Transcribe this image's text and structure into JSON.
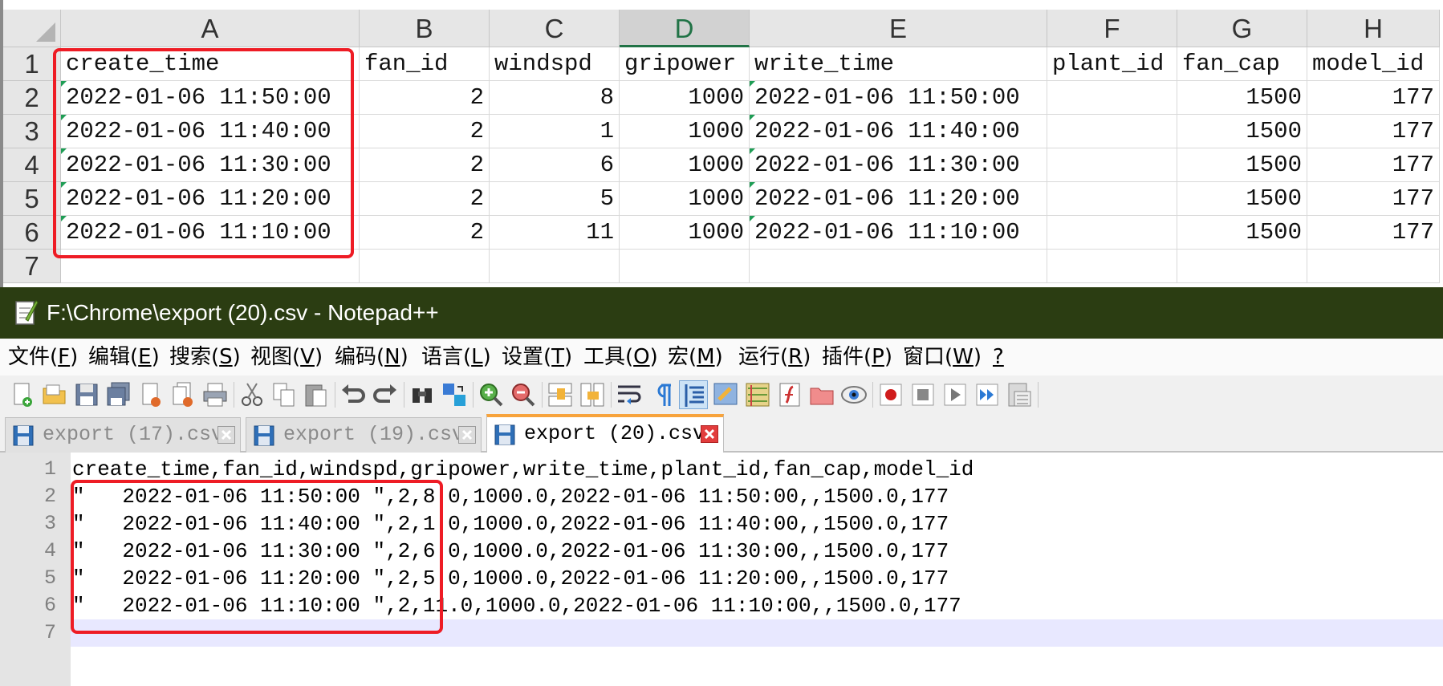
{
  "spreadsheet": {
    "columns": [
      "A",
      "B",
      "C",
      "D",
      "E",
      "F",
      "G",
      "H"
    ],
    "selected_column": "D",
    "row_numbers": [
      "1",
      "2",
      "3",
      "4",
      "5",
      "6",
      "7"
    ],
    "header": [
      "create_time",
      "fan_id",
      "windspd",
      "gripower",
      "write_time",
      "plant_id",
      "fan_cap",
      "model_id"
    ],
    "rows": [
      [
        "2022-01-06 11:50:00",
        "2",
        "8",
        "1000",
        "2022-01-06 11:50:00",
        "",
        "1500",
        "177"
      ],
      [
        "2022-01-06 11:40:00",
        "2",
        "1",
        "1000",
        "2022-01-06 11:40:00",
        "",
        "1500",
        "177"
      ],
      [
        "2022-01-06 11:30:00",
        "2",
        "6",
        "1000",
        "2022-01-06 11:30:00",
        "",
        "1500",
        "177"
      ],
      [
        "2022-01-06 11:20:00",
        "2",
        "5",
        "1000",
        "2022-01-06 11:20:00",
        "",
        "1500",
        "177"
      ],
      [
        "2022-01-06 11:10:00",
        "2",
        "11",
        "1000",
        "2022-01-06 11:10:00",
        "",
        "1500",
        "177"
      ]
    ]
  },
  "notepad": {
    "title": "F:\\Chrome\\export (20).csv - Notepad++",
    "menu": [
      {
        "pre": "文件(",
        "key": "F",
        "post": ")"
      },
      {
        "pre": "编辑(",
        "key": "E",
        "post": ")"
      },
      {
        "pre": "搜索(",
        "key": "S",
        "post": ")"
      },
      {
        "pre": "视图(",
        "key": "V",
        "post": ")"
      },
      {
        "pre": "编码(",
        "key": "N",
        "post": ")"
      },
      {
        "pre": "语言(",
        "key": "L",
        "post": ")"
      },
      {
        "pre": "设置(",
        "key": "T",
        "post": ")"
      },
      {
        "pre": "工具(",
        "key": "O",
        "post": ")"
      },
      {
        "pre": "宏(",
        "key": "M",
        "post": ")"
      },
      {
        "pre": "运行(",
        "key": "R",
        "post": ")"
      },
      {
        "pre": "插件(",
        "key": "P",
        "post": ")"
      },
      {
        "pre": "窗口(",
        "key": "W",
        "post": ")"
      },
      {
        "pre": "",
        "key": "?",
        "post": ""
      }
    ],
    "tabs": [
      {
        "label": "export (17).csv",
        "active": false
      },
      {
        "label": "export (19).csv",
        "active": false
      },
      {
        "label": "export (20).csv",
        "active": true
      }
    ],
    "line_numbers": [
      "1",
      "2",
      "3",
      "4",
      "5",
      "6",
      "7"
    ],
    "lines": [
      "create_time,fan_id,windspd,gripower,write_time,plant_id,fan_cap,model_id",
      "\"   2022-01-06 11:50:00 \",2,8.0,1000.0,2022-01-06 11:50:00,,1500.0,177",
      "\"   2022-01-06 11:40:00 \",2,1.0,1000.0,2022-01-06 11:40:00,,1500.0,177",
      "\"   2022-01-06 11:30:00 \",2,6.0,1000.0,2022-01-06 11:30:00,,1500.0,177",
      "\"   2022-01-06 11:20:00 \",2,5.0,1000.0,2022-01-06 11:20:00,,1500.0,177",
      "\"   2022-01-06 11:10:00 \",2,11.0,1000.0,2022-01-06 11:10:00,,1500.0,177",
      ""
    ],
    "toolbar_icons": [
      "new-file-icon",
      "open-file-icon",
      "save-icon",
      "save-all-icon",
      "close-icon",
      "close-all-icon",
      "print-icon",
      "cut-icon",
      "copy-icon",
      "paste-icon",
      "undo-icon",
      "redo-icon",
      "find-icon",
      "replace-icon",
      "zoom-in-icon",
      "zoom-out-icon",
      "sync-vertical-icon",
      "sync-horizontal-icon",
      "word-wrap-icon",
      "show-all-chars-icon",
      "indent-guide-icon",
      "udl-icon",
      "doc-map-icon",
      "function-list-icon",
      "folder-workspace-icon",
      "monitoring-icon",
      "record-macro-icon",
      "stop-record-icon",
      "play-macro-icon",
      "run-macro-multiple-icon",
      "save-macro-icon"
    ]
  },
  "colors": {
    "highlight": "#ee1c25",
    "titlebar": "#2b3d12",
    "excel_accent": "#217346",
    "tab_active_accent": "#f7a33c"
  }
}
